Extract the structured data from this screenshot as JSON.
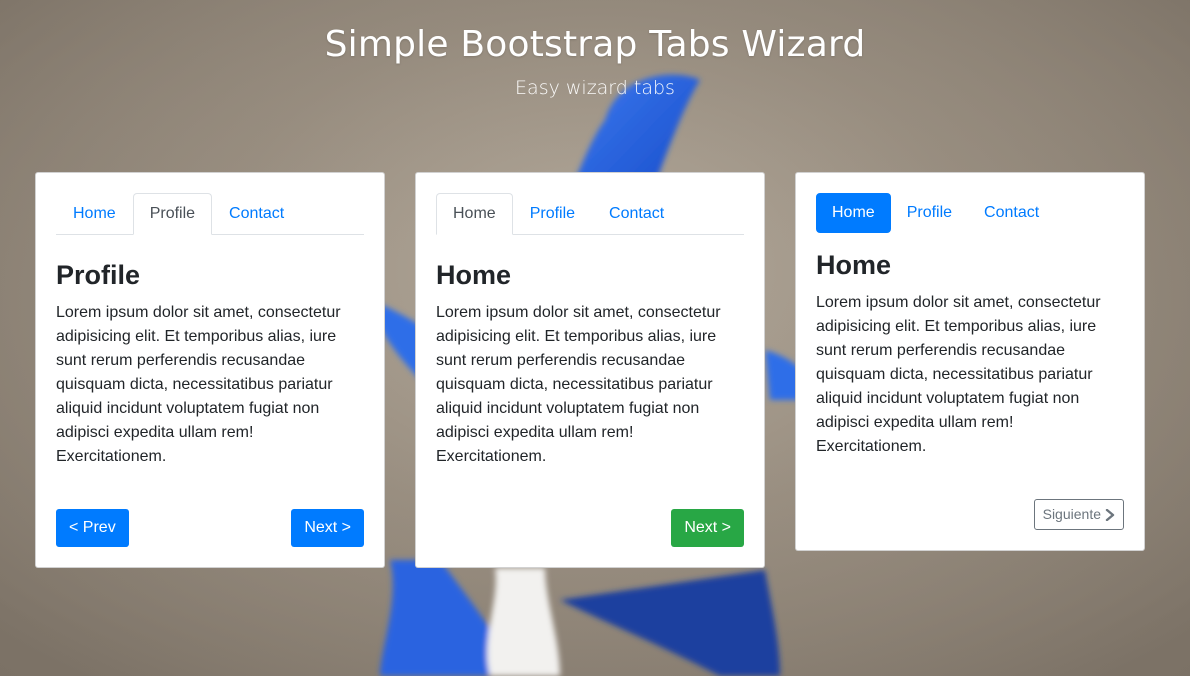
{
  "header": {
    "title": "Simple Bootstrap Tabs Wizard",
    "subtitle": "Easy wizard tabs"
  },
  "colors": {
    "primary": "#007bff",
    "success": "#28a745",
    "secondary": "#6c757d"
  },
  "cards": [
    {
      "tabs": [
        "Home",
        "Profile",
        "Contact"
      ],
      "active_tab": "Profile",
      "heading": "Profile",
      "text": "Lorem ipsum dolor sit amet, consectetur adipisicing elit. Et temporibus alias, iure sunt rerum perferendis recusandae quisquam dicta, necessitatibus pariatur aliquid incidunt voluptatem fugiat non adipisci expedita ullam rem! Exercitationem.",
      "prev_label": "< Prev",
      "next_label": "Next >"
    },
    {
      "tabs": [
        "Home",
        "Profile",
        "Contact"
      ],
      "active_tab": "Home",
      "heading": "Home",
      "text": "Lorem ipsum dolor sit amet, consectetur adipisicing elit. Et temporibus alias, iure sunt rerum perferendis recusandae quisquam dicta, necessitatibus pariatur aliquid incidunt voluptatem fugiat non adipisci expedita ullam rem! Exercitationem.",
      "next_label": "Next >"
    },
    {
      "tabs": [
        "Home",
        "Profile",
        "Contact"
      ],
      "active_tab": "Home",
      "heading": "Home",
      "text": "Lorem ipsum dolor sit amet, consectetur adipisicing elit. Et temporibus alias, iure sunt rerum perferendis recusandae quisquam dicta, necessitatibus pariatur aliquid incidunt voluptatem fugiat non adipisci expedita ullam rem! Exercitationem.",
      "next_label": "Siguiente",
      "next_icon": "chevron-right-icon"
    }
  ]
}
